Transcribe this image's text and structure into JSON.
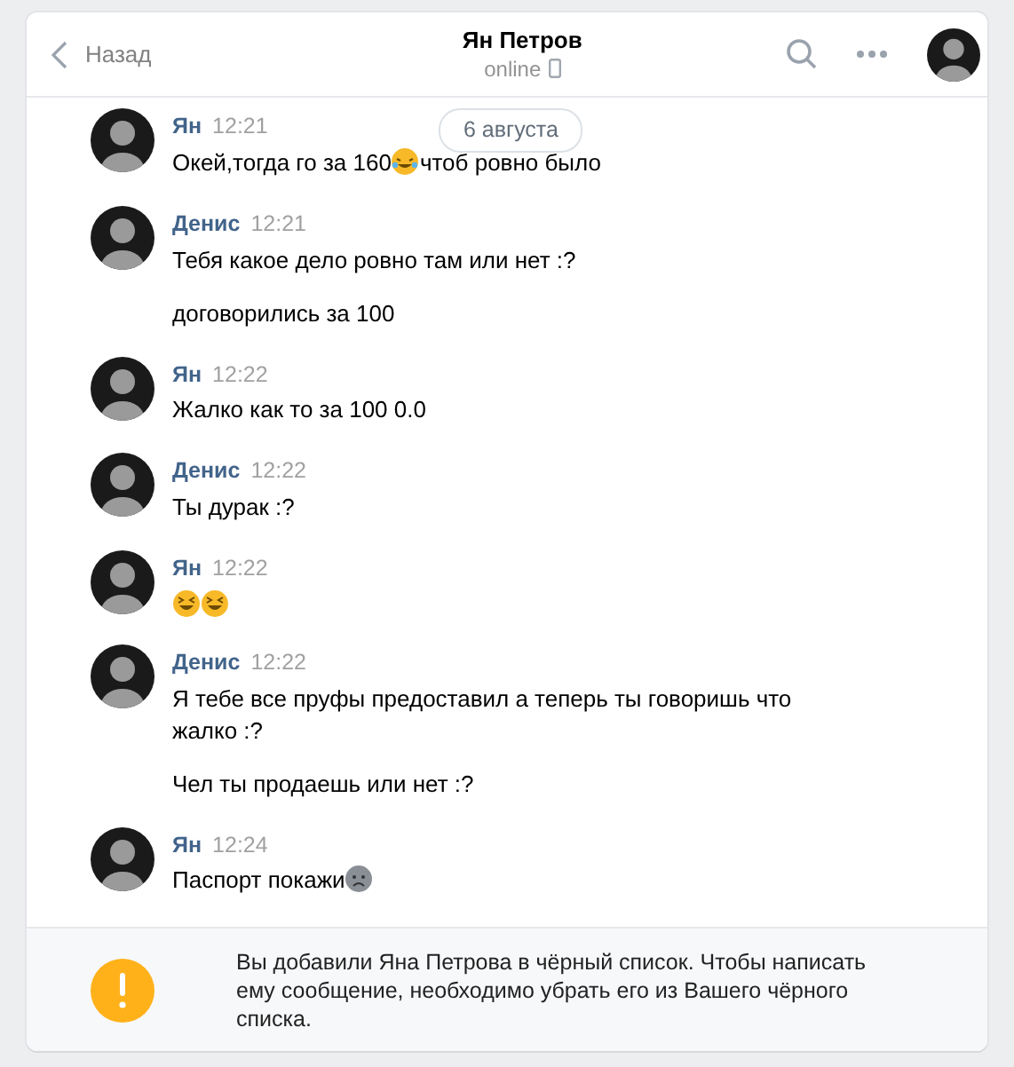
{
  "header": {
    "back": "Назад",
    "title": "Ян Петров",
    "status": "online"
  },
  "date_pill": "6 августа",
  "messages": [
    {
      "sender": "Ян",
      "time": "12:21",
      "lines": [
        [
          {
            "kind": "text",
            "text": "Окей,тогда го за 160"
          },
          {
            "kind": "laugh"
          },
          {
            "kind": "text",
            "text": "чтоб ровно было"
          }
        ]
      ]
    },
    {
      "sender": "Денис",
      "time": "12:21",
      "lines": [
        [
          {
            "kind": "text",
            "text": "Тебя какое дело ровно там или нет :?"
          }
        ],
        [
          {
            "kind": "text",
            "text": "договорились за 100"
          }
        ]
      ]
    },
    {
      "sender": "Ян",
      "time": "12:22",
      "lines": [
        [
          {
            "kind": "text",
            "text": "Жалко как то за 100 0.0"
          }
        ]
      ]
    },
    {
      "sender": "Денис",
      "time": "12:22",
      "lines": [
        [
          {
            "kind": "text",
            "text": "Ты дурак :?"
          }
        ]
      ]
    },
    {
      "sender": "Ян",
      "time": "12:22",
      "lines": [
        [
          {
            "kind": "squint"
          },
          {
            "kind": "squint"
          }
        ]
      ]
    },
    {
      "sender": "Денис",
      "time": "12:22",
      "lines": [
        [
          {
            "kind": "text",
            "text": "Я тебе все пруфы предоставил а теперь ты говоришь что жалко :?"
          }
        ],
        [
          {
            "kind": "text",
            "text": "Чел ты продаешь или нет :?"
          }
        ]
      ]
    },
    {
      "sender": "Ян",
      "time": "12:24",
      "lines": [
        [
          {
            "kind": "text",
            "text": "Паспорт покажи"
          },
          {
            "kind": "frown"
          }
        ]
      ]
    }
  ],
  "notice": {
    "text": "Вы добавили Яна Петрова в чёрный список. Чтобы написать ему сообщение, необходимо убрать его из Вашего чёрного списка."
  }
}
